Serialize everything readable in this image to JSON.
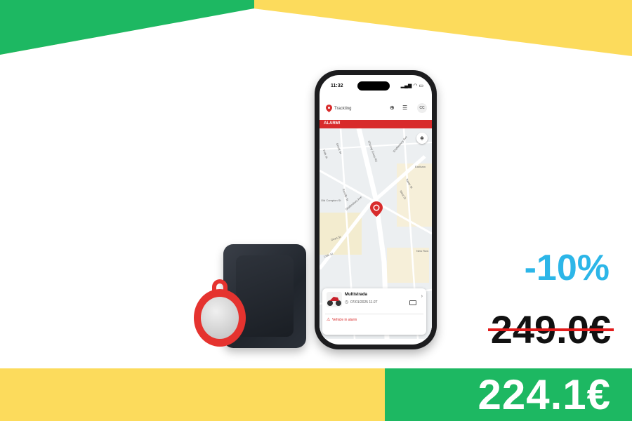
{
  "colors": {
    "accent_green": "#1DB862",
    "accent_yellow": "#FCDB5C",
    "discount_blue": "#2CB6E8",
    "strike_red": "#E21B1B",
    "brand_red": "#D82B2B"
  },
  "pricing": {
    "discount": "-10%",
    "old_price": "249.0€",
    "new_price": "224.1€"
  },
  "phone": {
    "status_time": "11:32",
    "status_icons": "▂▄▆ ◠ ▭",
    "app_name": "Trackting",
    "header_icons": {
      "add": "⊕",
      "list": "☰"
    },
    "avatar_initials": "CC",
    "alarm_label": "ALARM!",
    "layers_icon": "◈",
    "streets": [
      "Charing Cross Rd",
      "Shaftesbury Ave",
      "Frith St",
      "Greek St",
      "Old Compton St",
      "Romilly St",
      "Shaftesbury Ave",
      "Earlham",
      "Lisle St",
      "West St",
      "Tower St",
      "New Row",
      "Dean St"
    ],
    "vehicle_card": {
      "title": "Multistrada",
      "clock_icon": "◷",
      "datetime": "07/01/2025 11:27",
      "chevron": "›",
      "warning_icon": "⚠",
      "status": "Vehicle in alarm"
    }
  }
}
